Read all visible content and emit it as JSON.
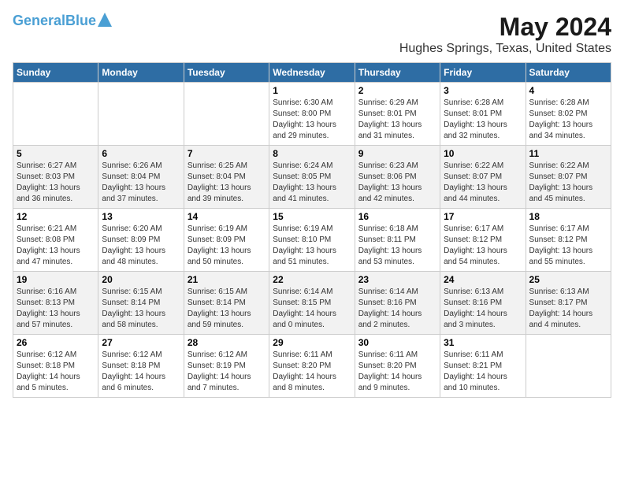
{
  "logo": {
    "line1": "General",
    "line2": "Blue"
  },
  "title": "May 2024",
  "subtitle": "Hughes Springs, Texas, United States",
  "days_of_week": [
    "Sunday",
    "Monday",
    "Tuesday",
    "Wednesday",
    "Thursday",
    "Friday",
    "Saturday"
  ],
  "weeks": [
    [
      {
        "day": "",
        "info": ""
      },
      {
        "day": "",
        "info": ""
      },
      {
        "day": "",
        "info": ""
      },
      {
        "day": "1",
        "info": "Sunrise: 6:30 AM\nSunset: 8:00 PM\nDaylight: 13 hours\nand 29 minutes."
      },
      {
        "day": "2",
        "info": "Sunrise: 6:29 AM\nSunset: 8:01 PM\nDaylight: 13 hours\nand 31 minutes."
      },
      {
        "day": "3",
        "info": "Sunrise: 6:28 AM\nSunset: 8:01 PM\nDaylight: 13 hours\nand 32 minutes."
      },
      {
        "day": "4",
        "info": "Sunrise: 6:28 AM\nSunset: 8:02 PM\nDaylight: 13 hours\nand 34 minutes."
      }
    ],
    [
      {
        "day": "5",
        "info": "Sunrise: 6:27 AM\nSunset: 8:03 PM\nDaylight: 13 hours\nand 36 minutes."
      },
      {
        "day": "6",
        "info": "Sunrise: 6:26 AM\nSunset: 8:04 PM\nDaylight: 13 hours\nand 37 minutes."
      },
      {
        "day": "7",
        "info": "Sunrise: 6:25 AM\nSunset: 8:04 PM\nDaylight: 13 hours\nand 39 minutes."
      },
      {
        "day": "8",
        "info": "Sunrise: 6:24 AM\nSunset: 8:05 PM\nDaylight: 13 hours\nand 41 minutes."
      },
      {
        "day": "9",
        "info": "Sunrise: 6:23 AM\nSunset: 8:06 PM\nDaylight: 13 hours\nand 42 minutes."
      },
      {
        "day": "10",
        "info": "Sunrise: 6:22 AM\nSunset: 8:07 PM\nDaylight: 13 hours\nand 44 minutes."
      },
      {
        "day": "11",
        "info": "Sunrise: 6:22 AM\nSunset: 8:07 PM\nDaylight: 13 hours\nand 45 minutes."
      }
    ],
    [
      {
        "day": "12",
        "info": "Sunrise: 6:21 AM\nSunset: 8:08 PM\nDaylight: 13 hours\nand 47 minutes."
      },
      {
        "day": "13",
        "info": "Sunrise: 6:20 AM\nSunset: 8:09 PM\nDaylight: 13 hours\nand 48 minutes."
      },
      {
        "day": "14",
        "info": "Sunrise: 6:19 AM\nSunset: 8:09 PM\nDaylight: 13 hours\nand 50 minutes."
      },
      {
        "day": "15",
        "info": "Sunrise: 6:19 AM\nSunset: 8:10 PM\nDaylight: 13 hours\nand 51 minutes."
      },
      {
        "day": "16",
        "info": "Sunrise: 6:18 AM\nSunset: 8:11 PM\nDaylight: 13 hours\nand 53 minutes."
      },
      {
        "day": "17",
        "info": "Sunrise: 6:17 AM\nSunset: 8:12 PM\nDaylight: 13 hours\nand 54 minutes."
      },
      {
        "day": "18",
        "info": "Sunrise: 6:17 AM\nSunset: 8:12 PM\nDaylight: 13 hours\nand 55 minutes."
      }
    ],
    [
      {
        "day": "19",
        "info": "Sunrise: 6:16 AM\nSunset: 8:13 PM\nDaylight: 13 hours\nand 57 minutes."
      },
      {
        "day": "20",
        "info": "Sunrise: 6:15 AM\nSunset: 8:14 PM\nDaylight: 13 hours\nand 58 minutes."
      },
      {
        "day": "21",
        "info": "Sunrise: 6:15 AM\nSunset: 8:14 PM\nDaylight: 13 hours\nand 59 minutes."
      },
      {
        "day": "22",
        "info": "Sunrise: 6:14 AM\nSunset: 8:15 PM\nDaylight: 14 hours\nand 0 minutes."
      },
      {
        "day": "23",
        "info": "Sunrise: 6:14 AM\nSunset: 8:16 PM\nDaylight: 14 hours\nand 2 minutes."
      },
      {
        "day": "24",
        "info": "Sunrise: 6:13 AM\nSunset: 8:16 PM\nDaylight: 14 hours\nand 3 minutes."
      },
      {
        "day": "25",
        "info": "Sunrise: 6:13 AM\nSunset: 8:17 PM\nDaylight: 14 hours\nand 4 minutes."
      }
    ],
    [
      {
        "day": "26",
        "info": "Sunrise: 6:12 AM\nSunset: 8:18 PM\nDaylight: 14 hours\nand 5 minutes."
      },
      {
        "day": "27",
        "info": "Sunrise: 6:12 AM\nSunset: 8:18 PM\nDaylight: 14 hours\nand 6 minutes."
      },
      {
        "day": "28",
        "info": "Sunrise: 6:12 AM\nSunset: 8:19 PM\nDaylight: 14 hours\nand 7 minutes."
      },
      {
        "day": "29",
        "info": "Sunrise: 6:11 AM\nSunset: 8:20 PM\nDaylight: 14 hours\nand 8 minutes."
      },
      {
        "day": "30",
        "info": "Sunrise: 6:11 AM\nSunset: 8:20 PM\nDaylight: 14 hours\nand 9 minutes."
      },
      {
        "day": "31",
        "info": "Sunrise: 6:11 AM\nSunset: 8:21 PM\nDaylight: 14 hours\nand 10 minutes."
      },
      {
        "day": "",
        "info": ""
      }
    ]
  ],
  "row_backgrounds": [
    "#ffffff",
    "#f2f2f2",
    "#ffffff",
    "#f2f2f2",
    "#ffffff"
  ]
}
